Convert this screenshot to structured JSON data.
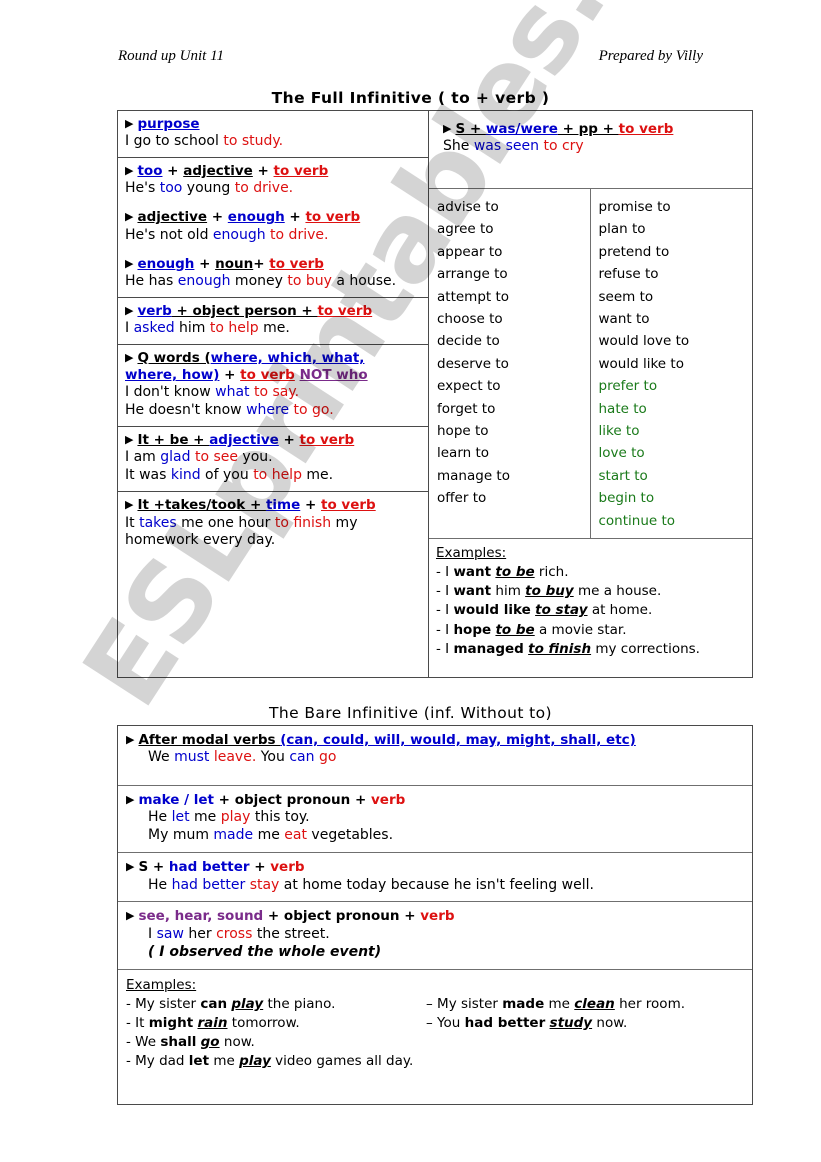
{
  "header": {
    "left": "Round up Unit 11",
    "right": "Prepared by Villy"
  },
  "titles": {
    "full": "The Full Infinitive ( to + verb )",
    "bare": "The Bare Infinitive (inf.  Without to)"
  },
  "watermark": "ESLprintables.com",
  "colors": {
    "blue": "#0000CC",
    "red": "#DD1111",
    "purple": "#7A2B8A",
    "green": "#1A7A1A",
    "border": "#4a4a4a"
  },
  "full_infinitive": {
    "left_cells": [
      {
        "rule_parts": [
          {
            "t": "purpose",
            "c": "blue",
            "u": true
          }
        ],
        "examples": [
          [
            {
              "t": "I go to school ",
              "c": "black"
            },
            {
              "t": "to study.",
              "c": "red"
            }
          ]
        ]
      },
      {
        "rule_parts": [
          {
            "t": "too",
            "c": "blue",
            "u": true
          },
          {
            "t": " + ",
            "c": "black"
          },
          {
            "t": "adjective",
            "c": "black",
            "u": true
          },
          {
            "t": " + ",
            "c": "black"
          },
          {
            "t": "to verb",
            "c": "red",
            "u": true
          }
        ],
        "examples": [
          [
            {
              "t": "He's ",
              "c": "black"
            },
            {
              "t": "too",
              "c": "blue"
            },
            {
              "t": " young ",
              "c": "black"
            },
            {
              "t": "to drive.",
              "c": "red"
            }
          ]
        ]
      },
      {
        "rule_parts": [
          {
            "t": "adjective",
            "c": "black",
            "u": true
          },
          {
            "t": " + ",
            "c": "black"
          },
          {
            "t": "enough",
            "c": "blue",
            "u": true
          },
          {
            "t": " + ",
            "c": "black"
          },
          {
            "t": "to verb",
            "c": "red",
            "u": true
          }
        ],
        "examples": [
          [
            {
              "t": "He's not old ",
              "c": "black"
            },
            {
              "t": "enough",
              "c": "blue"
            },
            {
              "t": " ",
              "c": "black"
            },
            {
              "t": "to drive.",
              "c": "red"
            }
          ]
        ]
      },
      {
        "rule_parts": [
          {
            "t": "enough",
            "c": "blue",
            "u": true
          },
          {
            "t": " + ",
            "c": "black"
          },
          {
            "t": "noun",
            "c": "black",
            "u": true
          },
          {
            "t": "+ ",
            "c": "black"
          },
          {
            "t": "to verb",
            "c": "red",
            "u": true
          }
        ],
        "examples": [
          [
            {
              "t": "He has ",
              "c": "black"
            },
            {
              "t": "enough",
              "c": "blue"
            },
            {
              "t": " money ",
              "c": "black"
            },
            {
              "t": "to buy",
              "c": "red"
            },
            {
              "t": " a house.",
              "c": "black"
            }
          ]
        ]
      },
      {
        "rule_parts": [
          {
            "t": "verb",
            "c": "blue",
            "u": true
          },
          {
            "t": " + object person + ",
            "c": "black",
            "u": true
          },
          {
            "t": "to verb",
            "c": "red",
            "u": true
          }
        ],
        "examples": [
          [
            {
              "t": "I ",
              "c": "black"
            },
            {
              "t": "asked",
              "c": "blue"
            },
            {
              "t": " him ",
              "c": "black"
            },
            {
              "t": "to help",
              "c": "red"
            },
            {
              "t": " me.",
              "c": "black"
            }
          ]
        ]
      },
      {
        "rule_parts": [
          {
            "t": "Q words (",
            "c": "black",
            "u": true
          },
          {
            "t": "where, which, what,",
            "c": "blue",
            "u": true
          },
          {
            "t": "BR",
            "c": "br"
          },
          {
            "t": "where, how)",
            "c": "blue",
            "u": true
          },
          {
            "t": "  + ",
            "c": "black"
          },
          {
            "t": "to verb",
            "c": "red",
            "u": true
          },
          {
            "t": "   ",
            "c": "black"
          },
          {
            "t": "NOT who",
            "c": "purple",
            "u": true
          }
        ],
        "examples": [
          [
            {
              "t": "I don't know ",
              "c": "black"
            },
            {
              "t": "what",
              "c": "blue"
            },
            {
              "t": " ",
              "c": "black"
            },
            {
              "t": "to say.",
              "c": "red"
            }
          ],
          [
            {
              "t": "He doesn't know ",
              "c": "black"
            },
            {
              "t": "where",
              "c": "blue"
            },
            {
              "t": " ",
              "c": "black"
            },
            {
              "t": "to go.",
              "c": "red"
            }
          ]
        ]
      },
      {
        "rule_parts": [
          {
            "t": "It + be + ",
            "c": "black",
            "u": true
          },
          {
            "t": "adjective",
            "c": "blue",
            "u": true
          },
          {
            "t": " + ",
            "c": "black"
          },
          {
            "t": "to verb",
            "c": "red",
            "u": true
          }
        ],
        "examples": [
          [
            {
              "t": "I am ",
              "c": "black"
            },
            {
              "t": "glad",
              "c": "blue"
            },
            {
              "t": " ",
              "c": "black"
            },
            {
              "t": "to see",
              "c": "red"
            },
            {
              "t": " you.",
              "c": "black"
            }
          ],
          [
            {
              "t": "It was ",
              "c": "black"
            },
            {
              "t": "kind",
              "c": "blue"
            },
            {
              "t": " of you ",
              "c": "black"
            },
            {
              "t": "to help",
              "c": "red"
            },
            {
              "t": " me.",
              "c": "black"
            }
          ]
        ]
      },
      {
        "rule_parts": [
          {
            "t": "It +takes/took + ",
            "c": "black",
            "u": true
          },
          {
            "t": "time",
            "c": "blue",
            "u": true
          },
          {
            "t": " + ",
            "c": "black"
          },
          {
            "t": "to verb",
            "c": "red",
            "u": true
          }
        ],
        "examples": [
          [
            {
              "t": "It ",
              "c": "black"
            },
            {
              "t": "takes",
              "c": "blue"
            },
            {
              "t": " me one hour ",
              "c": "black"
            },
            {
              "t": "to finish",
              "c": "red"
            },
            {
              "t": " my",
              "c": "black"
            }
          ],
          [
            {
              "t": "homework every day.",
              "c": "black"
            }
          ]
        ]
      }
    ],
    "passive_cell": {
      "rule_parts": [
        {
          "t": "S + ",
          "c": "black",
          "u": true
        },
        {
          "t": "was/were",
          "c": "blue",
          "u": true
        },
        {
          "t": " + pp + ",
          "c": "black",
          "u": true
        },
        {
          "t": "to verb",
          "c": "red",
          "u": true
        }
      ],
      "examples": [
        [
          {
            "t": "She ",
            "c": "black"
          },
          {
            "t": "was seen",
            "c": "blue"
          },
          {
            "t": " ",
            "c": "black"
          },
          {
            "t": "to cry",
            "c": "red"
          }
        ]
      ]
    },
    "verb_list": {
      "column_1": [
        {
          "t": "advise to",
          "c": "black"
        },
        {
          "t": "agree to",
          "c": "black"
        },
        {
          "t": "appear to",
          "c": "black"
        },
        {
          "t": "arrange to",
          "c": "black"
        },
        {
          "t": "attempt to",
          "c": "black"
        },
        {
          "t": "choose to",
          "c": "black"
        },
        {
          "t": "decide to",
          "c": "black"
        },
        {
          "t": "deserve to",
          "c": "black"
        },
        {
          "t": "expect to",
          "c": "black"
        },
        {
          "t": "forget to",
          "c": "black"
        },
        {
          "t": "hope to",
          "c": "black"
        },
        {
          "t": "learn to",
          "c": "black"
        },
        {
          "t": "manage to",
          "c": "black"
        },
        {
          "t": "offer to",
          "c": "black"
        }
      ],
      "column_2": [
        {
          "t": "promise to",
          "c": "black"
        },
        {
          "t": "plan to",
          "c": "black"
        },
        {
          "t": "pretend to",
          "c": "black"
        },
        {
          "t": "refuse to",
          "c": "black"
        },
        {
          "t": "seem to",
          "c": "black"
        },
        {
          "t": "want to",
          "c": "black"
        },
        {
          "t": "would love to",
          "c": "black"
        },
        {
          "t": "would like to",
          "c": "black"
        },
        {
          "t": "prefer to",
          "c": "green"
        },
        {
          "t": "hate to",
          "c": "green"
        },
        {
          "t": "like to",
          "c": "green"
        },
        {
          "t": "love to",
          "c": "green"
        },
        {
          "t": "start to",
          "c": "green"
        },
        {
          "t": "begin to",
          "c": "green"
        },
        {
          "t": "continue to",
          "c": "green"
        }
      ]
    },
    "examples_block": {
      "heading": "Examples:",
      "items": [
        "- I <b>want</b> <b><i><u>to be</u></i></b> rich.",
        "- I <b>want</b>  him <b><i><u>to buy</u></i></b> me a house.",
        "- I <b>would  like</b> <b><i><u>to stay</u></i></b> at home.",
        "- I <b>hope</b> <b><i><u>to be</u></i></b> a movie star.",
        "- I <b>managed</b> <b><i><u>to finish</u></i></b> my corrections."
      ]
    }
  },
  "bare_infinitive": {
    "cells": [
      {
        "rule_parts": [
          {
            "t": "After modal verbs ",
            "c": "black",
            "u": true
          },
          {
            "t": " (can, could, will, would, may, might, shall, etc)",
            "c": "blue",
            "u": true
          }
        ],
        "examples": [
          [
            {
              "t": "We ",
              "c": "black"
            },
            {
              "t": "must",
              "c": "blue"
            },
            {
              "t": " ",
              "c": "black"
            },
            {
              "t": "leave.",
              "c": "red"
            },
            {
              "t": "            ",
              "c": "black"
            },
            {
              "t": "You ",
              "c": "black"
            },
            {
              "t": "can",
              "c": "blue"
            },
            {
              "t": " ",
              "c": "black"
            },
            {
              "t": "go",
              "c": "red"
            }
          ]
        ]
      },
      {
        "rule_parts": [
          {
            "t": "make / let",
            "c": "blue"
          },
          {
            "t": " + object pronoun + ",
            "c": "black"
          },
          {
            "t": "verb",
            "c": "red"
          }
        ],
        "examples": [
          [
            {
              "t": "He ",
              "c": "black"
            },
            {
              "t": "let",
              "c": "blue"
            },
            {
              "t": " me ",
              "c": "black"
            },
            {
              "t": "play",
              "c": "red"
            },
            {
              "t": " this toy.",
              "c": "black"
            }
          ],
          [
            {
              "t": "My mum ",
              "c": "black"
            },
            {
              "t": "made",
              "c": "blue"
            },
            {
              "t": " me ",
              "c": "black"
            },
            {
              "t": "eat",
              "c": "red"
            },
            {
              "t": " vegetables.",
              "c": "black"
            }
          ]
        ]
      },
      {
        "rule_parts": [
          {
            "t": "S + ",
            "c": "black"
          },
          {
            "t": "had better",
            "c": "blue"
          },
          {
            "t": " + ",
            "c": "black"
          },
          {
            "t": "verb",
            "c": "red"
          }
        ],
        "examples": [
          [
            {
              "t": "He ",
              "c": "black"
            },
            {
              "t": "had better",
              "c": "blue"
            },
            {
              "t": " ",
              "c": "black"
            },
            {
              "t": "stay",
              "c": "red"
            },
            {
              "t": " at home today because he isn't feeling well.",
              "c": "black"
            }
          ]
        ]
      },
      {
        "rule_parts": [
          {
            "t": "see, hear, sound",
            "c": "purple"
          },
          {
            "t": "  +  object pronoun + ",
            "c": "black"
          },
          {
            "t": "verb",
            "c": "red"
          }
        ],
        "examples": [
          [
            {
              "t": "I ",
              "c": "black"
            },
            {
              "t": "saw",
              "c": "blue"
            },
            {
              "t": " her ",
              "c": "black"
            },
            {
              "t": "cross",
              "c": "red"
            },
            {
              "t": " the street.",
              "c": "black"
            }
          ],
          [
            {
              "t": "ITALIC:( I observed the whole event)",
              "c": "black"
            }
          ]
        ]
      }
    ],
    "examples_block": {
      "heading": "Examples:",
      "col1": [
        "- My sister <b>can</b> <b><i><u>play</u></i></b> the piano.",
        "- It <b>might</b> <b><i><u>rain</u></i></b> tomorrow.",
        "- We <b>shall</b> <b><i><u>go</u></i></b> now.",
        "- My dad <b>let</b> me <b><i><u>play</u></i></b> video games all day."
      ],
      "col2": [
        "– My sister <b>made</b> me <b><i><u>clean</u></i></b> her room.",
        "– You <b>had better</b> <b><i><u>study</u></i></b> now."
      ]
    }
  }
}
